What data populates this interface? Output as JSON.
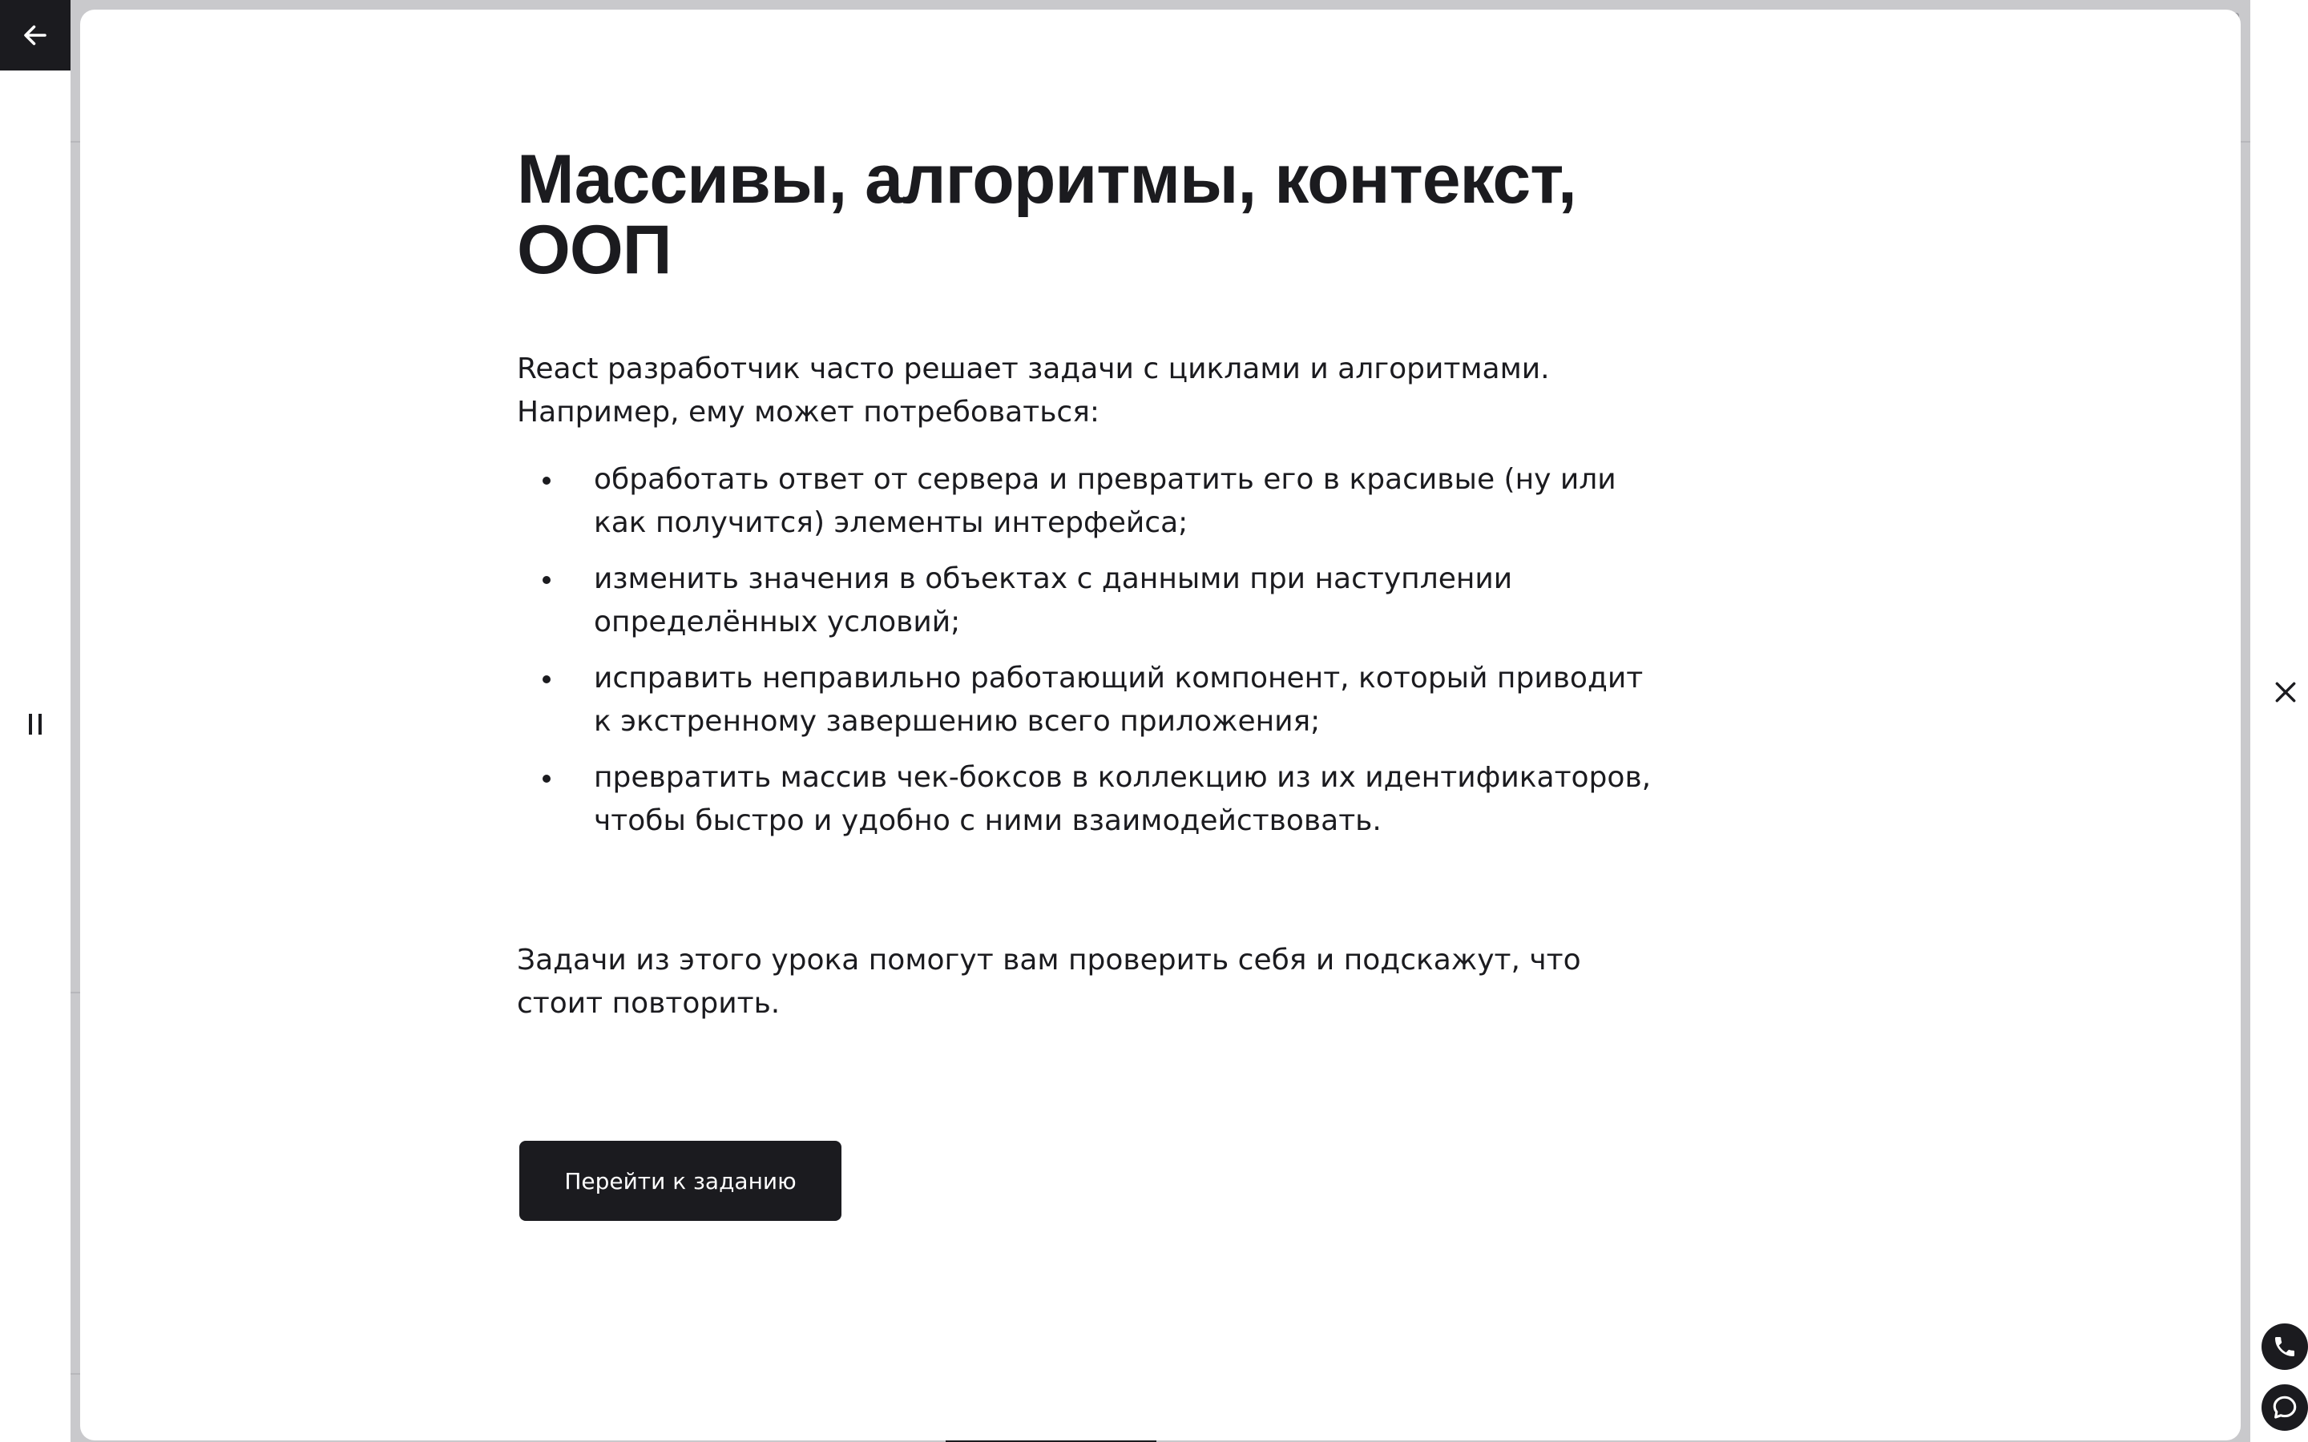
{
  "modal": {
    "title": "Массивы, алгоритмы, контекст, ООП",
    "intro": "React разработчик часто решает задачи с циклами и алгоритмами. Например, ему может потребоваться:",
    "bullets": [
      "обработать ответ от сервера и превратить его в красивые (ну или как получится) элементы интерфейса;",
      "изменить значения в объектах с данными при наступлении определённых условий;",
      "исправить неправильно работающий компонент, который приводит к экстренному завершению всего приложения;",
      "превратить массив чек-боксов в коллекцию из их идентификаторов, чтобы быстро и удобно с ними взаимодействовать."
    ],
    "outro": "Задачи из этого урока помогут вам проверить себя и подскажут, что стоит повторить.",
    "cta_label": "Перейти к заданию"
  },
  "icons": {
    "back": "arrow-left-icon",
    "pause": "pause-icon",
    "close": "close-icon",
    "phone": "phone-icon",
    "chat": "chat-icon"
  },
  "colors": {
    "primary_dark": "#1b1b1f",
    "background": "#ffffff",
    "backdrop": "#c9c9cc"
  }
}
